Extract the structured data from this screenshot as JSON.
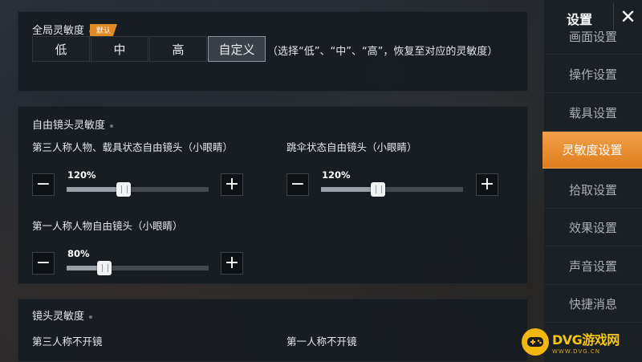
{
  "global": {
    "title": "全局灵敏度",
    "options": [
      "低",
      "中",
      "高",
      "自定义"
    ],
    "selected": "自定义",
    "default_tag": "默认",
    "note": "（选择“低”、“中”、“高”，恢复至对应的灵敏度）"
  },
  "free_cam": {
    "title": "自由镜头灵敏度",
    "items": [
      {
        "label": "第三人称人物、载具状态自由镜头（小眼睛）",
        "value": "120%",
        "fraction": 0.4
      },
      {
        "label": "跳伞状态自由镜头（小眼睛）",
        "value": "120%",
        "fraction": 0.4
      },
      {
        "label": "第一人称人物自由镜头（小眼睛）",
        "value": "80%",
        "fraction": 0.27
      }
    ]
  },
  "lens": {
    "title": "镜头灵敏度",
    "items": [
      "第三人称不开镜",
      "第一人称不开镜"
    ]
  },
  "sidebar": {
    "title": "设置",
    "items": [
      "画面设置",
      "操作设置",
      "载具设置",
      "灵敏度设置",
      "拾取设置",
      "效果设置",
      "声音设置",
      "快捷消息"
    ],
    "active": "灵敏度设置"
  },
  "watermark": {
    "brand": "DVG游戏网",
    "url": "WWW.DVG.CN"
  },
  "icons": {
    "minus": "minus-icon",
    "plus": "plus-icon",
    "close": "close-icon"
  },
  "colors": {
    "accent": "#e8891f"
  }
}
